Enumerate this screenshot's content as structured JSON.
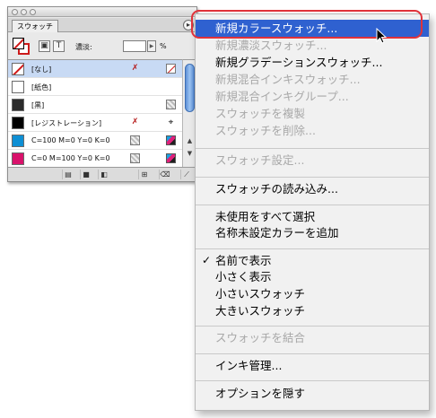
{
  "panel": {
    "tab_label": "スウォッチ",
    "panel_menu_icon": "panel-menu-triangle",
    "tint_label": "濃淡:",
    "tint_value": "",
    "tint_unit": "%",
    "swatches": [
      {
        "label": "[なし]",
        "chip": "none",
        "icon_a": "lock-icon",
        "icon_b": "none-delete-icon",
        "selected": true
      },
      {
        "label": "[紙色]",
        "chip": "paper",
        "icon_a": "",
        "icon_b": "",
        "selected": false
      },
      {
        "label": "[黒]",
        "chip": "black",
        "icon_a": "",
        "icon_b": "process-icon",
        "selected": false
      },
      {
        "label": "[レジストレーション]",
        "chip": "reg",
        "icon_a": "lock-icon",
        "icon_b": "registration-icon",
        "selected": false
      },
      {
        "label": "C=100 M=0 Y=0 K=0",
        "chip": "cyan",
        "icon_a": "process-icon",
        "icon_b": "cmyk-icon",
        "selected": false
      },
      {
        "label": "C=0 M=100 Y=0 K=0",
        "chip": "magenta",
        "icon_a": "process-icon",
        "icon_b": "cmyk-icon",
        "selected": false
      }
    ],
    "glyphs": {
      "lock": "✗",
      "target": "⌖",
      "menu": "▸",
      "up": "▲",
      "down": "▼",
      "new": "⊞",
      "trash": "🗑"
    }
  },
  "menu": {
    "items": [
      {
        "label": "新規カラースウォッチ...",
        "state": "highlighted"
      },
      {
        "label": "新規濃淡スウォッチ...",
        "state": "disabled"
      },
      {
        "label": "新規グラデーションスウォッチ...",
        "state": "enabled"
      },
      {
        "label": "新規混合インキスウォッチ...",
        "state": "disabled"
      },
      {
        "label": "新規混合インキグループ...",
        "state": "disabled"
      },
      {
        "label": "スウォッチを複製",
        "state": "disabled"
      },
      {
        "label": "スウォッチを削除...",
        "state": "disabled"
      },
      {
        "label": "スウォッチ設定...",
        "state": "disabled"
      },
      {
        "label": "スウォッチの読み込み...",
        "state": "enabled"
      },
      {
        "label": "未使用をすべて選択",
        "state": "enabled"
      },
      {
        "label": "名称未設定カラーを追加",
        "state": "enabled"
      },
      {
        "label": "名前で表示",
        "state": "checked"
      },
      {
        "label": "小さく表示",
        "state": "enabled"
      },
      {
        "label": "小さいスウォッチ",
        "state": "enabled"
      },
      {
        "label": "大きいスウォッチ",
        "state": "enabled"
      },
      {
        "label": "スウォッチを結合",
        "state": "disabled"
      },
      {
        "label": "インキ管理...",
        "state": "enabled"
      },
      {
        "label": "オプションを隠す",
        "state": "enabled"
      }
    ],
    "check_glyph": "✓",
    "highlight_color": "#2f61d0",
    "callout_color": "#e0323a"
  }
}
